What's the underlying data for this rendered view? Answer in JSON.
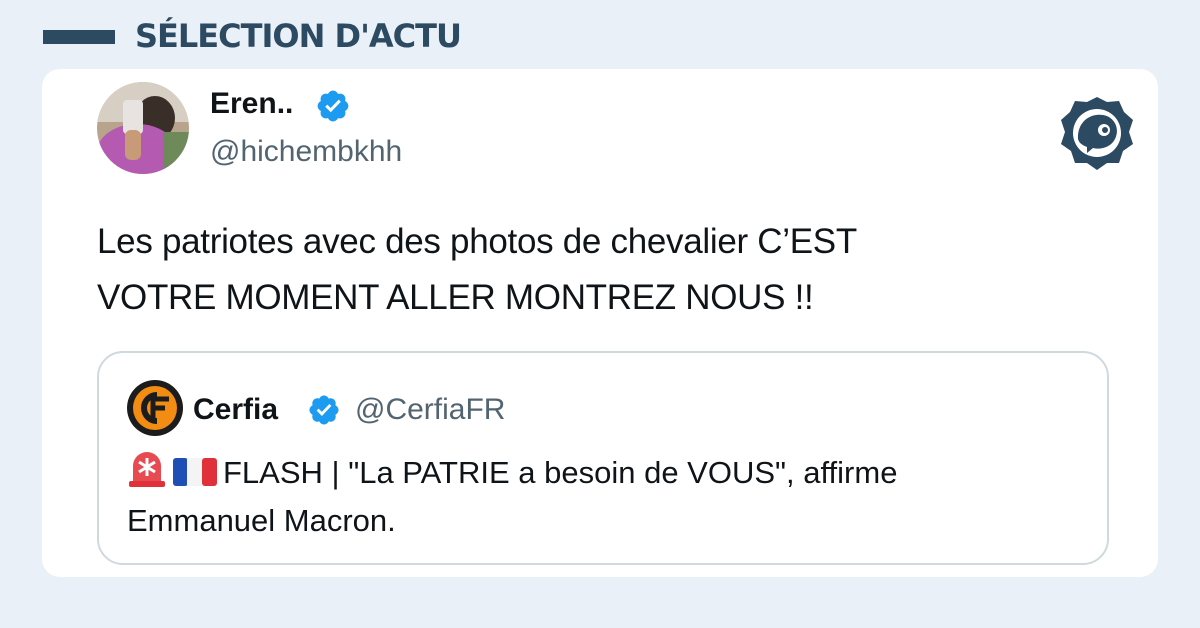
{
  "header": {
    "title": "SÉLECTION D'ACTU"
  },
  "tweet": {
    "author_name": "Eren..",
    "author_handle": "@hichembkhh",
    "text_line1": "Les patriotes avec des photos de chevalier C’EST",
    "text_line2": "VOTRE MOMENT ALLER MONTREZ NOUS !!",
    "verified_icon": "verified-badge-icon",
    "brand_icon": "brand-logo-icon"
  },
  "quote": {
    "author_name": "Cerfia",
    "author_handle": "@CerfiaFR",
    "text_line1": "FLASH | \"La PATRIE a besoin de VOUS\", affirme",
    "text_line2": "Emmanuel Macron.",
    "emoji_1": "rotating-light-emoji",
    "emoji_2": "french-flag-emoji"
  },
  "colors": {
    "background": "#e9f0f8",
    "header": "#2d4a63",
    "verified": "#1d9bf0",
    "text": "#0f1419",
    "muted": "#536471"
  }
}
